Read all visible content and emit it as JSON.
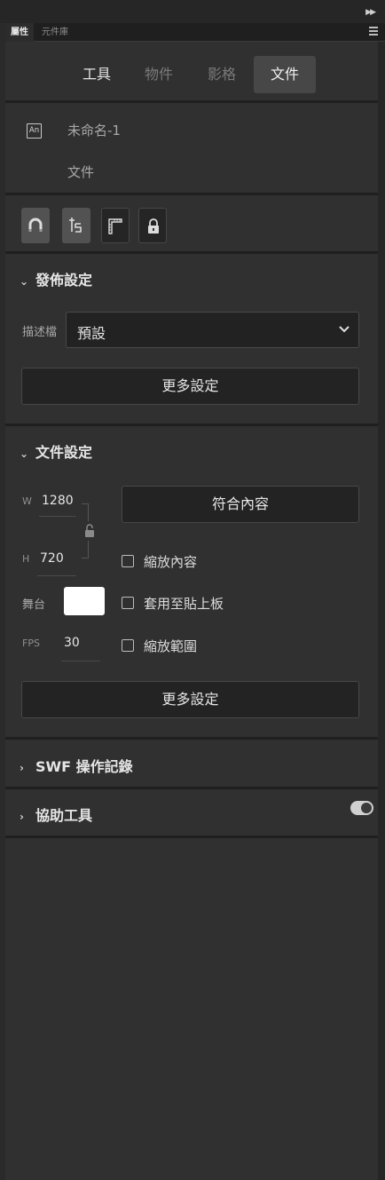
{
  "panel_tabs": {
    "properties": "屬性",
    "library": "元件庫"
  },
  "mode_tabs": [
    {
      "label": "工具",
      "state": "enabled"
    },
    {
      "label": "物件",
      "state": "disabled"
    },
    {
      "label": "影格",
      "state": "disabled"
    },
    {
      "label": "文件",
      "state": "selected"
    }
  ],
  "document": {
    "icon_text": "An",
    "name": "未命名-1",
    "type": "文件"
  },
  "tool_buttons": [
    {
      "icon": "magnet-icon",
      "state": "on"
    },
    {
      "icon": "snap-to-objects-icon",
      "state": "on"
    },
    {
      "icon": "ruler-icon",
      "state": "off"
    },
    {
      "icon": "lock-icon",
      "state": "off"
    }
  ],
  "publish": {
    "title": "發佈設定",
    "profile_label": "描述檔",
    "profile_value": "預設",
    "more_settings": "更多設定"
  },
  "doc_settings": {
    "title": "文件設定",
    "w_label": "W",
    "w_value": "1280",
    "h_label": "H",
    "h_value": "720",
    "fit_content": "符合內容",
    "stage_label": "舞台",
    "stage_color": "#ffffff",
    "fps_label": "FPS",
    "fps_value": "30",
    "scale_content": "縮放內容",
    "apply_pasteboard": "套用至貼上板",
    "scale_spans": "縮放範圍",
    "more_settings": "更多設定"
  },
  "swf_history": {
    "title": "SWF 操作記錄"
  },
  "accessibility": {
    "title": "協助工具",
    "toggle_on": true
  }
}
